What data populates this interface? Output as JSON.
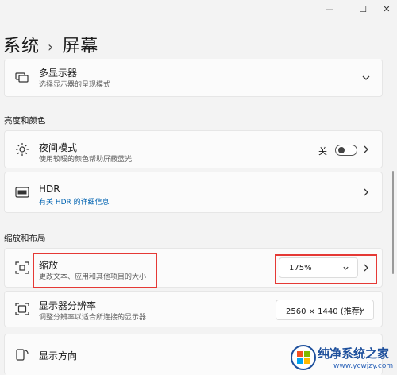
{
  "window": {
    "minimize_glyph": "—",
    "maximize_glyph": "☐",
    "close_glyph": "✕"
  },
  "breadcrumb": {
    "parent": "系统",
    "separator": "›",
    "current": "屏幕"
  },
  "multi_display": {
    "title": "多显示器",
    "subtitle": "选择显示器的呈现模式",
    "icon": "multi-display-icon"
  },
  "sections": {
    "brightness_color": "亮度和颜色",
    "scale_layout": "缩放和布局"
  },
  "night_light": {
    "title": "夜间模式",
    "subtitle": "使用较暖的颜色帮助屏蔽蓝光",
    "toggle_label": "关",
    "toggle_on": false,
    "icon": "brightness-icon"
  },
  "hdr": {
    "title": "HDR",
    "link": "有关 HDR 的详细信息",
    "icon": "hdr-icon"
  },
  "scale": {
    "title": "缩放",
    "subtitle": "更改文本、应用和其他项目的大小",
    "value": "175%",
    "icon": "scale-icon"
  },
  "resolution": {
    "title": "显示器分辨率",
    "subtitle": "调整分辨率以适合所连接的显示器",
    "value": "2560 × 1440 (推荐)",
    "icon": "resolution-icon"
  },
  "orientation": {
    "title": "显示方向",
    "icon": "orientation-icon"
  },
  "watermark": {
    "text": "纯净系统之家",
    "url": "www.ycwjzy.com"
  },
  "colors": {
    "accent": "#0063b1",
    "highlight": "#e53935",
    "background": "#f3f3f3",
    "card": "#fbfbfb"
  }
}
